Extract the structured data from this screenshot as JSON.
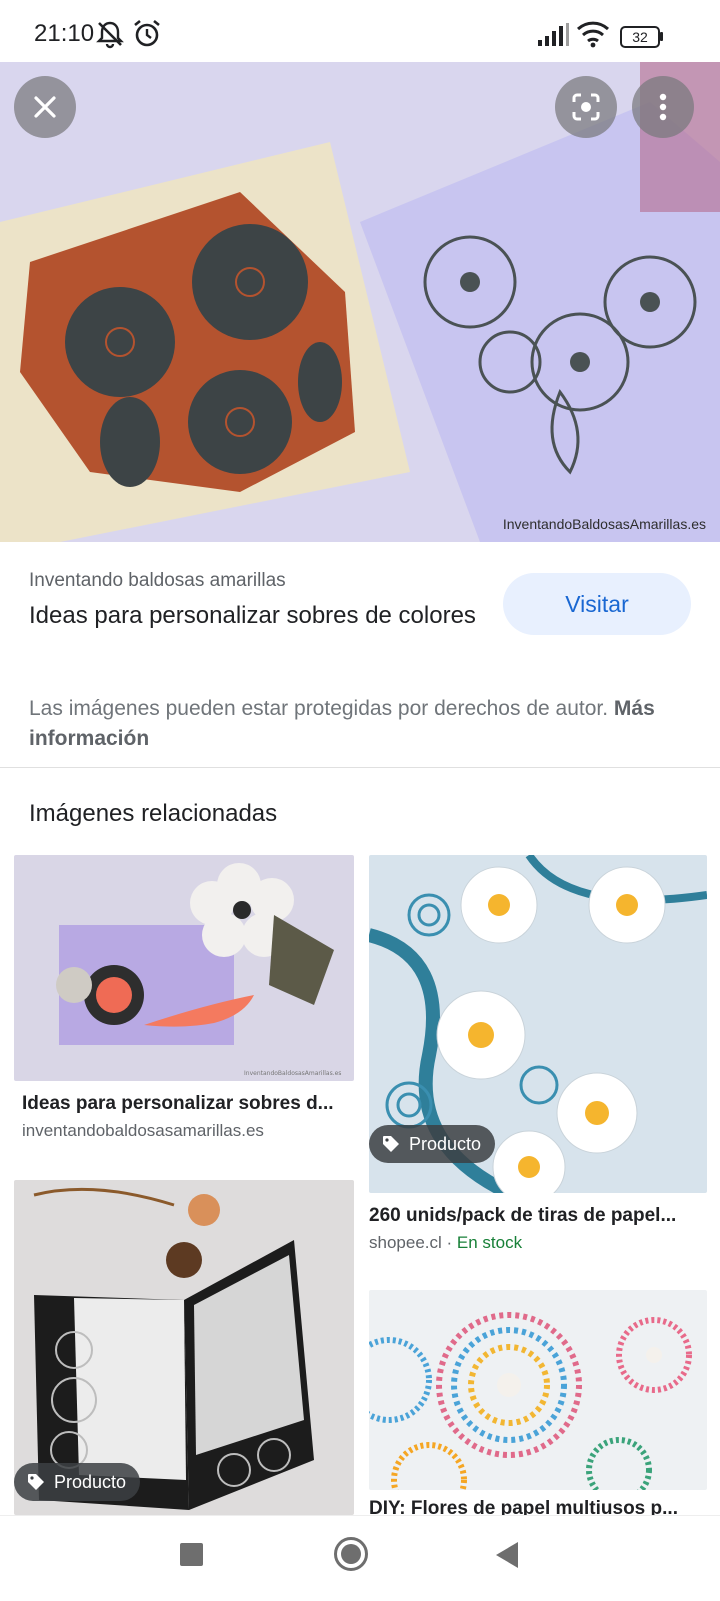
{
  "status_bar": {
    "time": "21:10",
    "icons": [
      "mute-notifications-icon",
      "alarm-icon",
      "signal-icon",
      "wifi-icon",
      "battery-icon"
    ],
    "battery": "32"
  },
  "hero": {
    "credit": "InventandoBaldosasAmarillas.es",
    "buttons": [
      "close-icon",
      "lens-icon",
      "more-vert-icon"
    ]
  },
  "info": {
    "source": "Inventando baldosas amarillas",
    "title": "Ideas para personalizar sobres de colores",
    "visit_label": "Visitar",
    "copyright_text": "Las imágenes pueden estar protegidas por derechos de autor.",
    "more_info": "Más información"
  },
  "related": {
    "heading": "Imágenes relacionadas",
    "cards": [
      {
        "title": "Ideas para personalizar sobres d...",
        "domain": "inventandobaldosasamarillas.es",
        "badge": "",
        "stock": ""
      },
      {
        "title": "260 unids/pack de tiras de papel...",
        "domain": "shopee.cl",
        "badge": "Producto",
        "stock": "En stock"
      },
      {
        "title": "",
        "domain": "",
        "badge": "Producto",
        "stock": ""
      },
      {
        "title": "DIY: Flores de papel multiusos p...",
        "domain": "",
        "badge": "",
        "stock": ""
      }
    ],
    "separator": " · "
  },
  "nav": [
    "recents-icon",
    "home-icon",
    "back-icon"
  ],
  "colors": {
    "accent": "#1967d2",
    "visit_bg": "#e8f0fe",
    "stock": "#188038"
  }
}
